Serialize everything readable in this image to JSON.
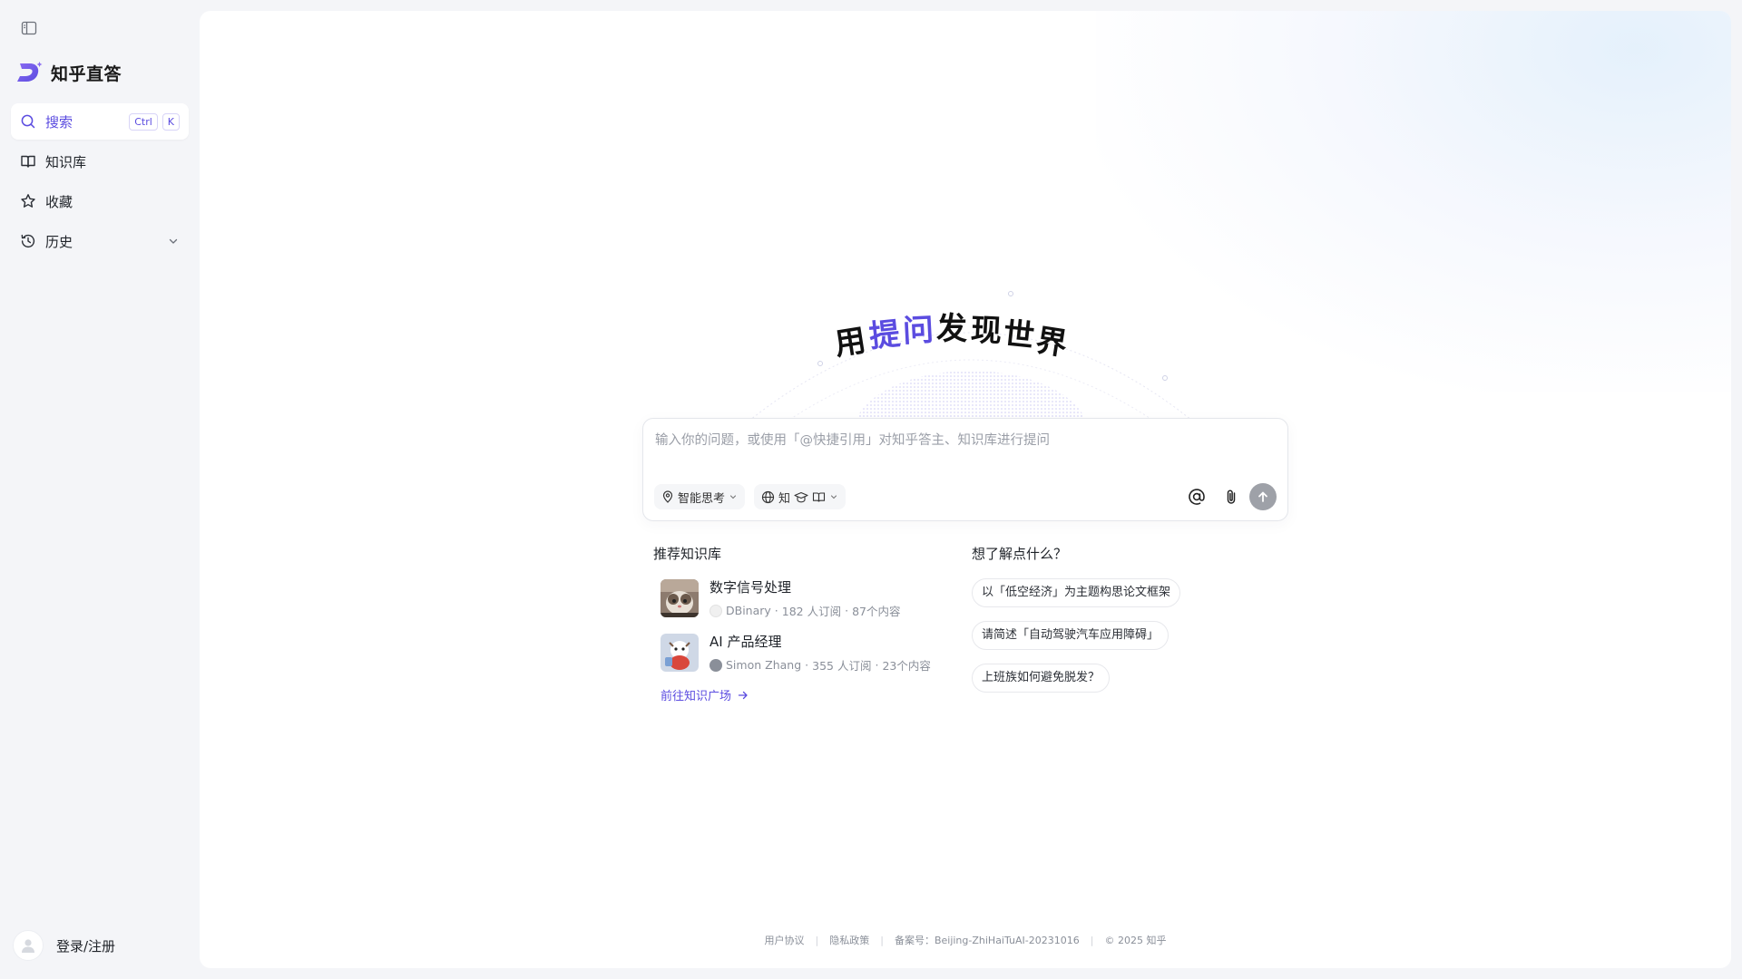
{
  "brand": {
    "name": "知乎直答"
  },
  "sidebar": {
    "items": [
      {
        "label": "搜索",
        "kbd": [
          "Ctrl",
          "K"
        ]
      },
      {
        "label": "知识库"
      },
      {
        "label": "收藏"
      },
      {
        "label": "历史"
      }
    ],
    "login_label": "登录/注册"
  },
  "hero": {
    "chars": [
      "用",
      "提",
      "问",
      "发",
      "现",
      "世",
      "界"
    ],
    "accent_color": "#5b4ce0"
  },
  "ask": {
    "placeholder": "输入你的问题，或使用「@快捷引用」对知乎答主、知识库进行提问",
    "think_label": "智能思考",
    "source_label": "知"
  },
  "recommend": {
    "title": "推荐知识库",
    "items": [
      {
        "title": "数字信号处理",
        "author": "DBinary",
        "subs": "182 人订阅",
        "count": "87个内容"
      },
      {
        "title": "AI 产品经理",
        "author": "Simon Zhang",
        "subs": "355 人订阅",
        "count": "23个内容"
      }
    ],
    "link_label": "前往知识广场"
  },
  "wants": {
    "title": "想了解点什么？",
    "suggestions": [
      "以「低空经济」为主题构思论文框架",
      "请简述「自动驾驶汽车应用障碍」",
      "上班族如何避免脱发？"
    ]
  },
  "footer": {
    "agreement": "用户协议",
    "privacy": "隐私政策",
    "icp": "备案号：Beijing-ZhiHaiTuAI-20231016",
    "copyright": "© 2025 知乎"
  }
}
